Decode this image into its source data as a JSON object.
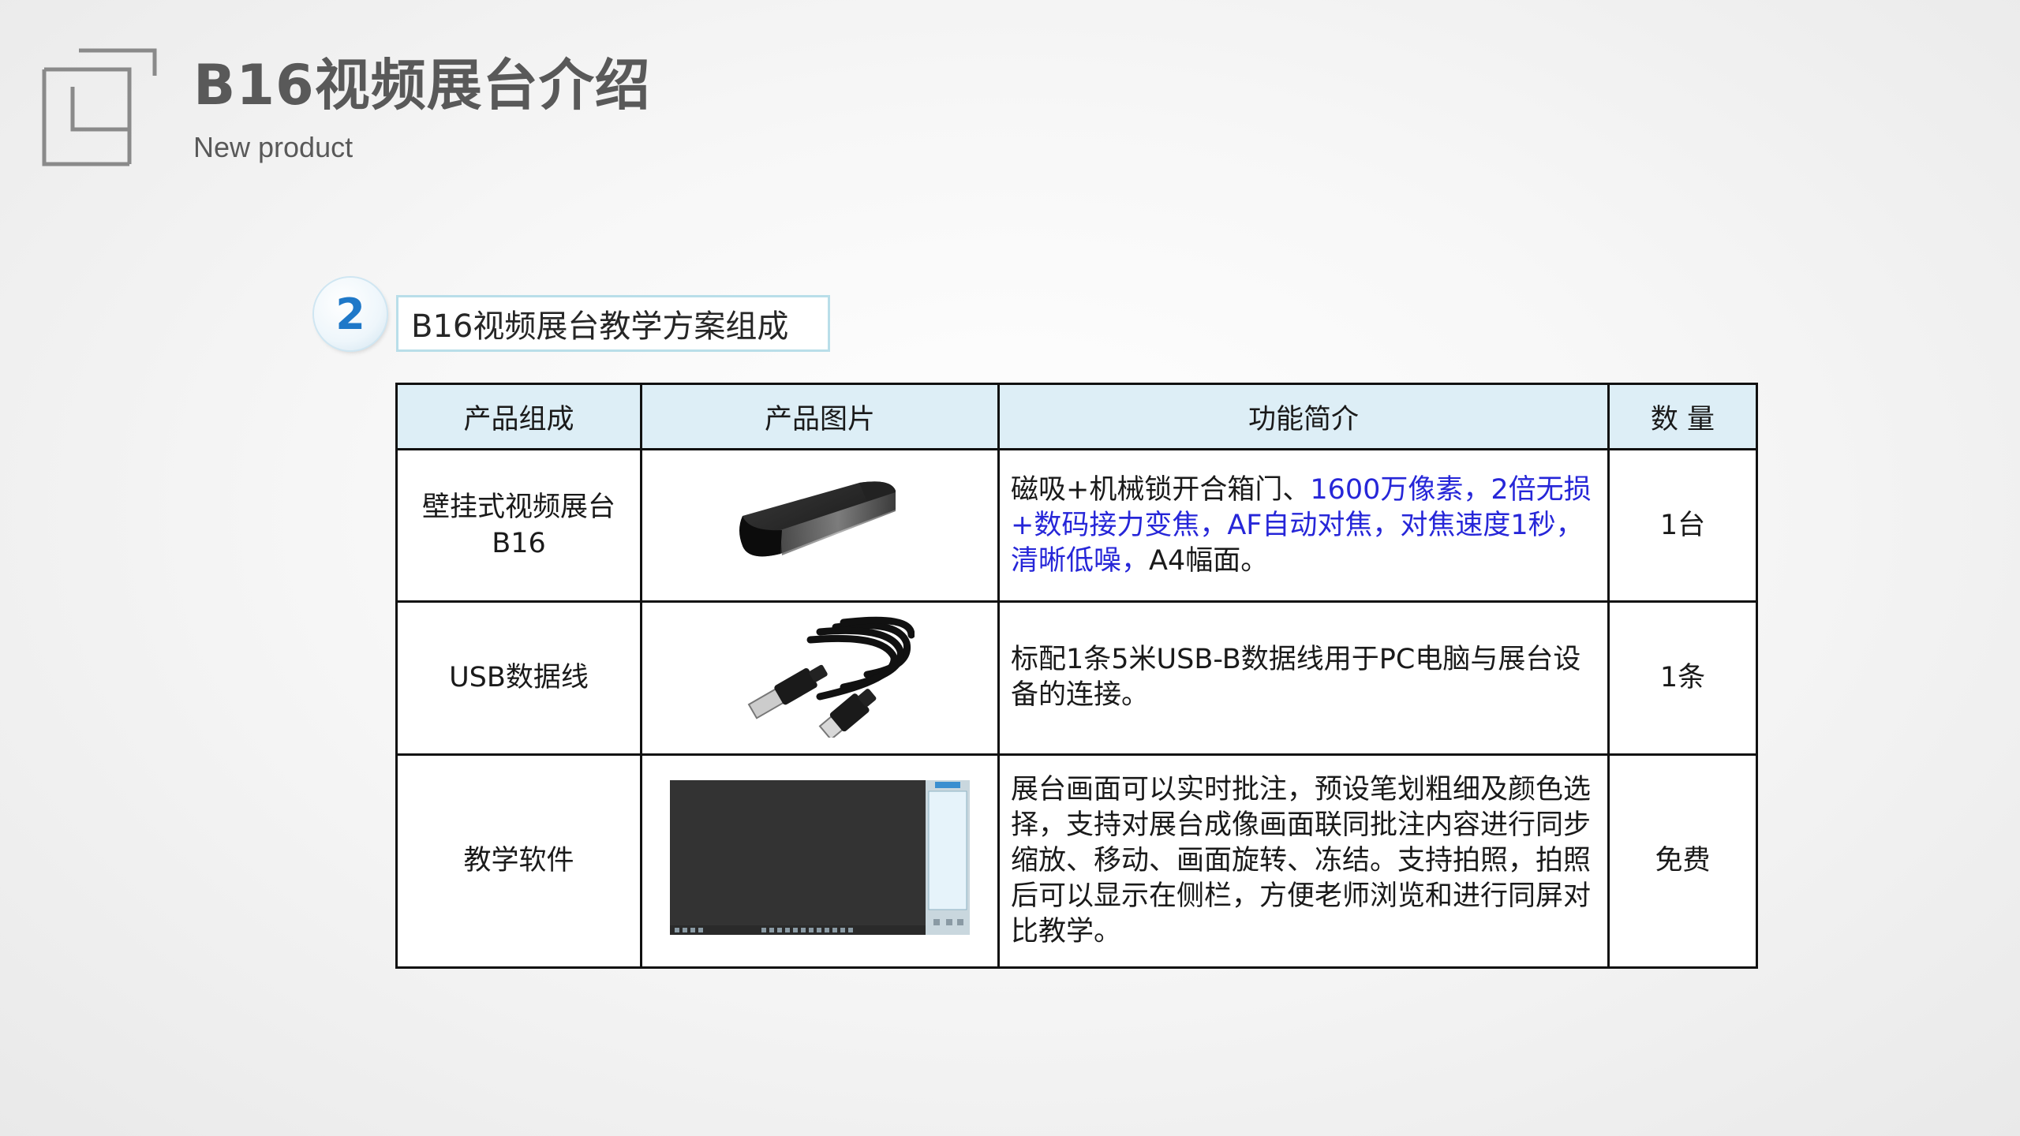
{
  "header": {
    "title": "B16视频展台介绍",
    "subtitle": "New product"
  },
  "section": {
    "number": "2",
    "title": "B16视频展台教学方案组成"
  },
  "table": {
    "headers": [
      "产品组成",
      "产品图片",
      "功能简介",
      "数 量"
    ],
    "rows": [
      {
        "component_line1": "壁挂式视频展台",
        "component_line2": "B16",
        "image": "black-box-document-camera",
        "desc_plain1": "磁吸+机械锁开合箱门、",
        "desc_blue": "1600万像素，2倍无损+数码接力变焦，AF自动对焦，对焦速度1秒，清晰低噪，",
        "desc_plain2": "A4幅面。",
        "quantity": "1台"
      },
      {
        "component": "USB数据线",
        "image": "usb-cable",
        "description": "标配1条5米USB-B数据线用于PC电脑与展台设备的连接。",
        "quantity": "1条"
      },
      {
        "component": "教学软件",
        "image": "software-screenshot",
        "description": "展台画面可以实时批注，预设笔划粗细及颜色选择，支持对展台成像画面联同批注内容进行同步缩放、移动、画面旋转、冻结。支持拍照，拍照后可以显示在侧栏，方便老师浏览和进行同屏对比教学。",
        "quantity": "免费"
      }
    ]
  },
  "colors": {
    "title": "#595959",
    "header_fill": "#ddeef6",
    "accent_blue": "#2626d8",
    "circle_number": "#1f78c8"
  }
}
